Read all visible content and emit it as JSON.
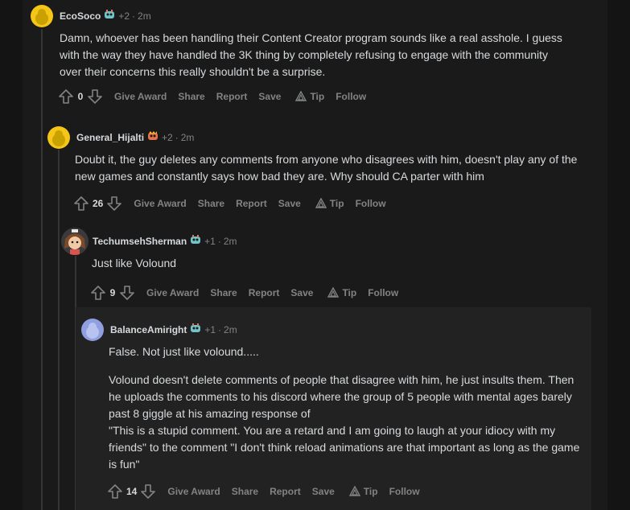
{
  "comments": [
    {
      "user": "EcoSoco",
      "meta": "+2",
      "time": "2m",
      "body": [
        "Damn, whoever has been handling their Content Creator program sounds like a real asshole. I guess with the way they have handled the 3K thing by completely refusing to engage with the community over their concerns this really shouldn't be a surprise."
      ],
      "score": "0"
    },
    {
      "user": "General_Hijalti",
      "meta": "+2",
      "time": "2m",
      "body": [
        "Doubt it, the guy deletes any comments from anyone who disagrees with him, doesn't play any of the new games and constantly says how bad they are. Why should CA parter with him"
      ],
      "score": "26"
    },
    {
      "user": "TechumsehSherman",
      "meta": "+1",
      "time": "2m",
      "body": [
        "Just like Volound"
      ],
      "score": "9"
    },
    {
      "user": "BalanceAmiright",
      "meta": "+1",
      "time": "2m",
      "body": [
        "False. Not just like volound.....",
        "Volound doesn't delete comments of people that disagree with him, he just insults them. Then he uploads the comments to his discord where the group of 5 people with mental ages barely past 8 giggle at his amazing response of",
        "\"This is a stupid comment. You are a retard and I am going to laugh at your idiocy with my friends\" to the comment \"I don't think reload animations are that important as long as the game is fun\""
      ],
      "score": "14"
    }
  ],
  "actions": {
    "give_award": "Give Award",
    "share": "Share",
    "report": "Report",
    "save": "Save",
    "tip": "Tip",
    "follow": "Follow"
  },
  "separator": "·",
  "colors": {
    "background": "#1a1a1b",
    "text": "#d7dadc",
    "muted": "#818384",
    "line": "#343536"
  }
}
